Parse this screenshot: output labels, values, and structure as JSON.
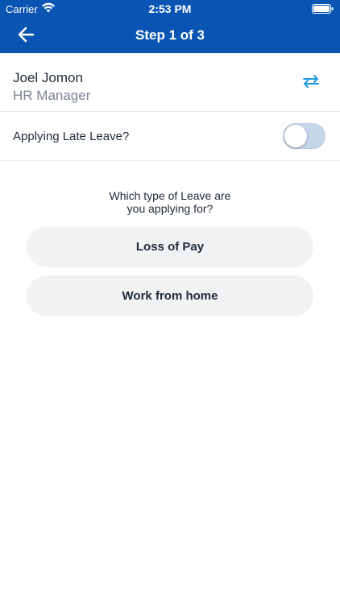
{
  "status_bar": {
    "carrier": "Carrier",
    "time": "2:53 PM"
  },
  "header": {
    "title": "Step 1 of 3",
    "back_icon": "arrow-left-icon"
  },
  "user": {
    "name": "Joel Jomon",
    "role": "HR Manager",
    "switch_icon": "swap-arrows-icon"
  },
  "late_leave": {
    "label": "Applying Late Leave?",
    "enabled": false
  },
  "leave_type": {
    "question_line1": "Which type of Leave are",
    "question_line2": "you applying for?",
    "options": [
      "Loss of Pay",
      "Work from home"
    ]
  },
  "colors": {
    "header": "#0a55b3",
    "accent": "#1e9be0",
    "option_bg": "#f1f2f4"
  }
}
